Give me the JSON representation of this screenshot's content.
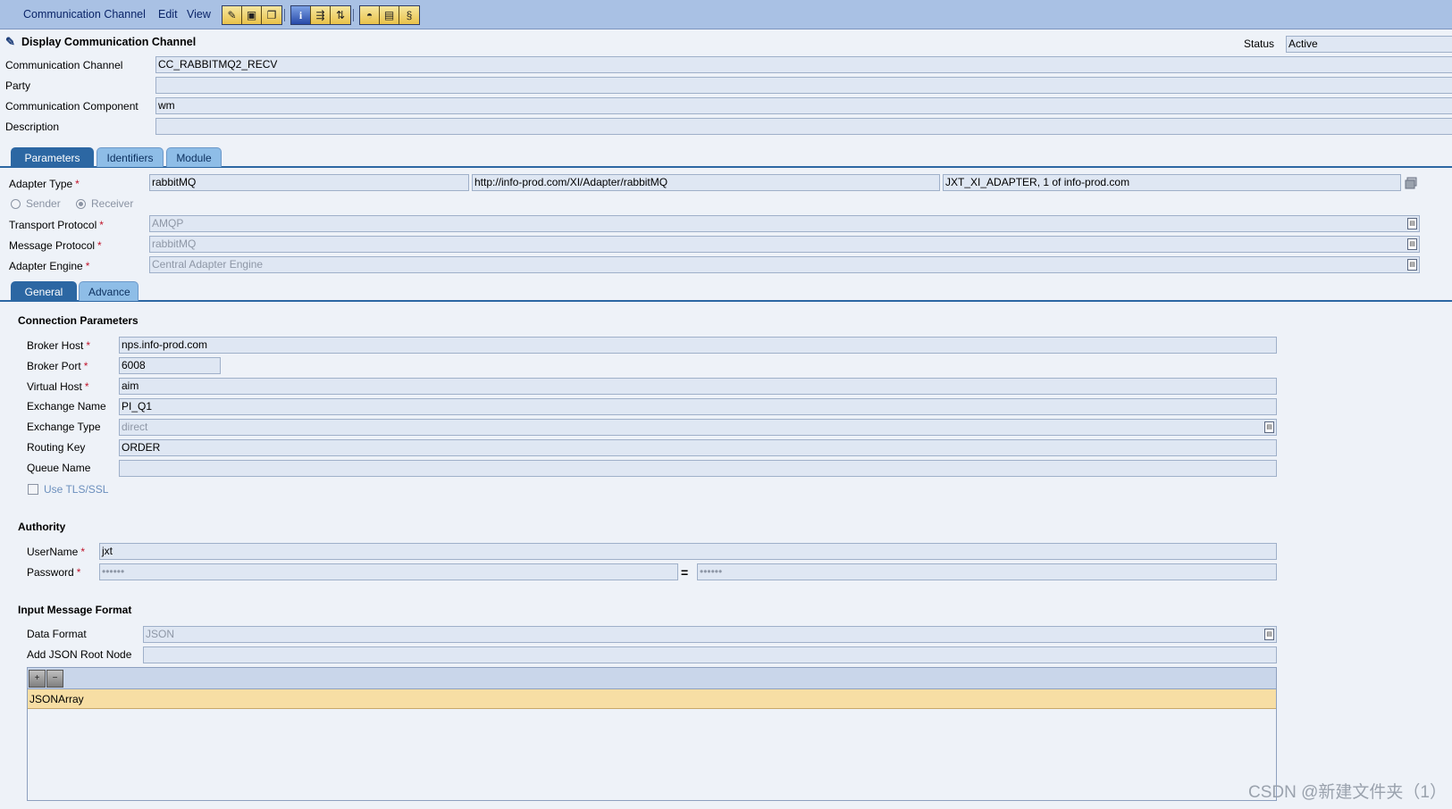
{
  "menu": {
    "items": [
      "Communication Channel",
      "Edit",
      "View"
    ]
  },
  "header": {
    "title": "Display Communication Channel",
    "status_label": "Status",
    "status_value": "Active",
    "channel_label": "Communication Channel",
    "channel_value": "CC_RABBITMQ2_RECV",
    "party_label": "Party",
    "party_value": "",
    "component_label": "Communication Component",
    "component_value": "wm",
    "description_label": "Description",
    "description_value": ""
  },
  "main_tabs": [
    "Parameters",
    "Identifiers",
    "Module"
  ],
  "parameters": {
    "adapter_type_label": "Adapter Type",
    "adapter_type_value": "rabbitMQ",
    "adapter_namespace": "http://info-prod.com/XI/Adapter/rabbitMQ",
    "adapter_swcv": "JXT_XI_ADAPTER, 1 of info-prod.com",
    "sender_label": "Sender",
    "receiver_label": "Receiver",
    "direction_selected": "Receiver",
    "transport_protocol_label": "Transport Protocol",
    "transport_protocol_value": "AMQP",
    "message_protocol_label": "Message Protocol",
    "message_protocol_value": "rabbitMQ",
    "adapter_engine_label": "Adapter Engine",
    "adapter_engine_value": "Central Adapter Engine"
  },
  "sub_tabs": [
    "General",
    "Advance"
  ],
  "connection": {
    "title": "Connection Parameters",
    "broker_host_label": "Broker Host",
    "broker_host_value": "nps.info-prod.com",
    "broker_port_label": "Broker Port",
    "broker_port_value": "6008",
    "virtual_host_label": "Virtual Host",
    "virtual_host_value": "aim",
    "exchange_name_label": "Exchange Name",
    "exchange_name_value": "PI_Q1",
    "exchange_type_label": "Exchange Type",
    "exchange_type_value": "direct",
    "routing_key_label": "Routing Key",
    "routing_key_value": "ORDER",
    "queue_name_label": "Queue Name",
    "queue_name_value": "",
    "tls_label": "Use TLS/SSL"
  },
  "authority": {
    "title": "Authority",
    "username_label": "UserName",
    "username_value": "jxt",
    "password_label": "Password",
    "password_value": "••••••",
    "password_confirm_value": "••••••",
    "equals": "="
  },
  "input_format": {
    "title": "Input Message Format",
    "data_format_label": "Data Format",
    "data_format_value": "JSON",
    "root_node_label": "Add JSON Root Node",
    "root_node_value": "",
    "rows": [
      "JSONArray"
    ]
  },
  "watermark": "CSDN @新建文件夹（1）",
  "colors": {
    "menubar": "#a9c1e4",
    "tab_active": "#2c67a3",
    "tab_inactive": "#8ebde7",
    "field_bg": "#dfe7f3",
    "row_selected": "#f7dea4"
  }
}
